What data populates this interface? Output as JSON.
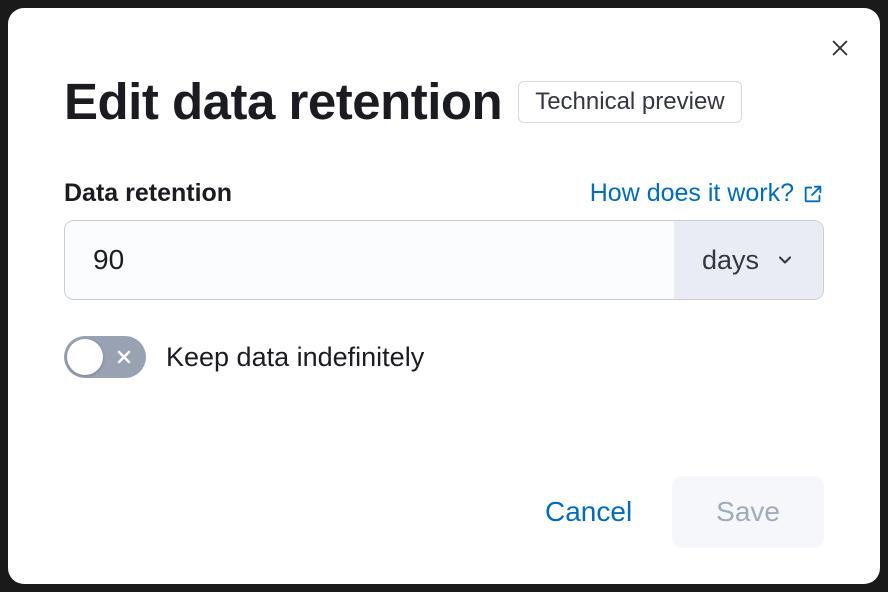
{
  "modal": {
    "title": "Edit data retention",
    "badge": "Technical preview",
    "close_aria": "Close"
  },
  "field": {
    "label": "Data retention",
    "help_link": "How does it work?",
    "value": "90",
    "unit": "days"
  },
  "toggle": {
    "label": "Keep data indefinitely",
    "state": "off"
  },
  "footer": {
    "cancel": "Cancel",
    "save": "Save"
  },
  "colors": {
    "link": "#006bb8",
    "text": "#1a1c21",
    "muted": "#98a2b3",
    "disabled_bg": "#f5f7fa",
    "disabled_text": "#a2abba"
  }
}
